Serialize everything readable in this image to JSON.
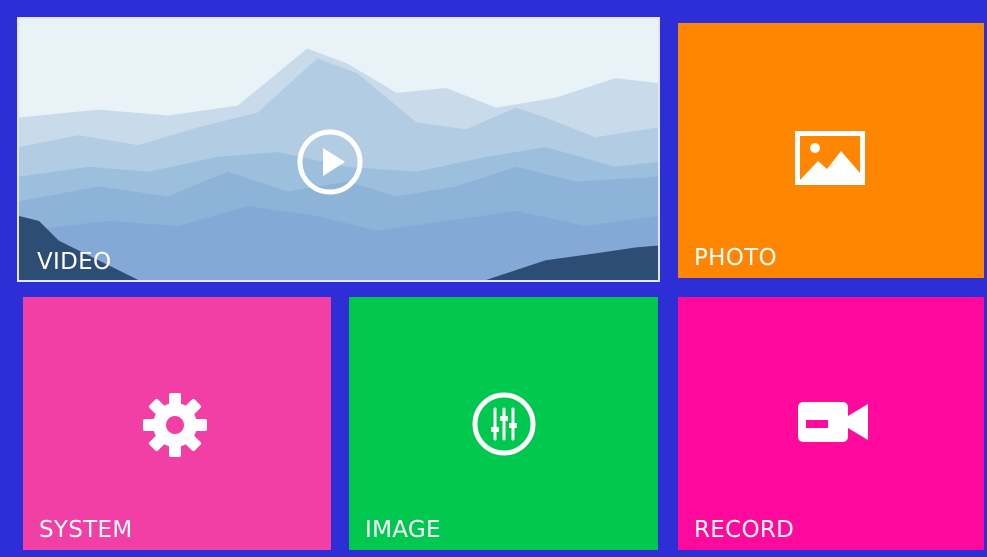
{
  "colors": {
    "background": "#2e2ed6",
    "video": "#e9f2f6",
    "photo": "#ff8600",
    "system": "#f23fa5",
    "image": "#00c84e",
    "record": "#ff0a9c"
  },
  "tiles": {
    "video": {
      "label": "VIDEO",
      "icon": "play-circle-icon"
    },
    "photo": {
      "label": "PHOTO",
      "icon": "picture-icon"
    },
    "system": {
      "label": "SYSTEM",
      "icon": "gear-icon"
    },
    "image": {
      "label": "IMAGE",
      "icon": "sliders-circle-icon"
    },
    "record": {
      "label": "RECORD",
      "icon": "video-camera-icon"
    }
  }
}
